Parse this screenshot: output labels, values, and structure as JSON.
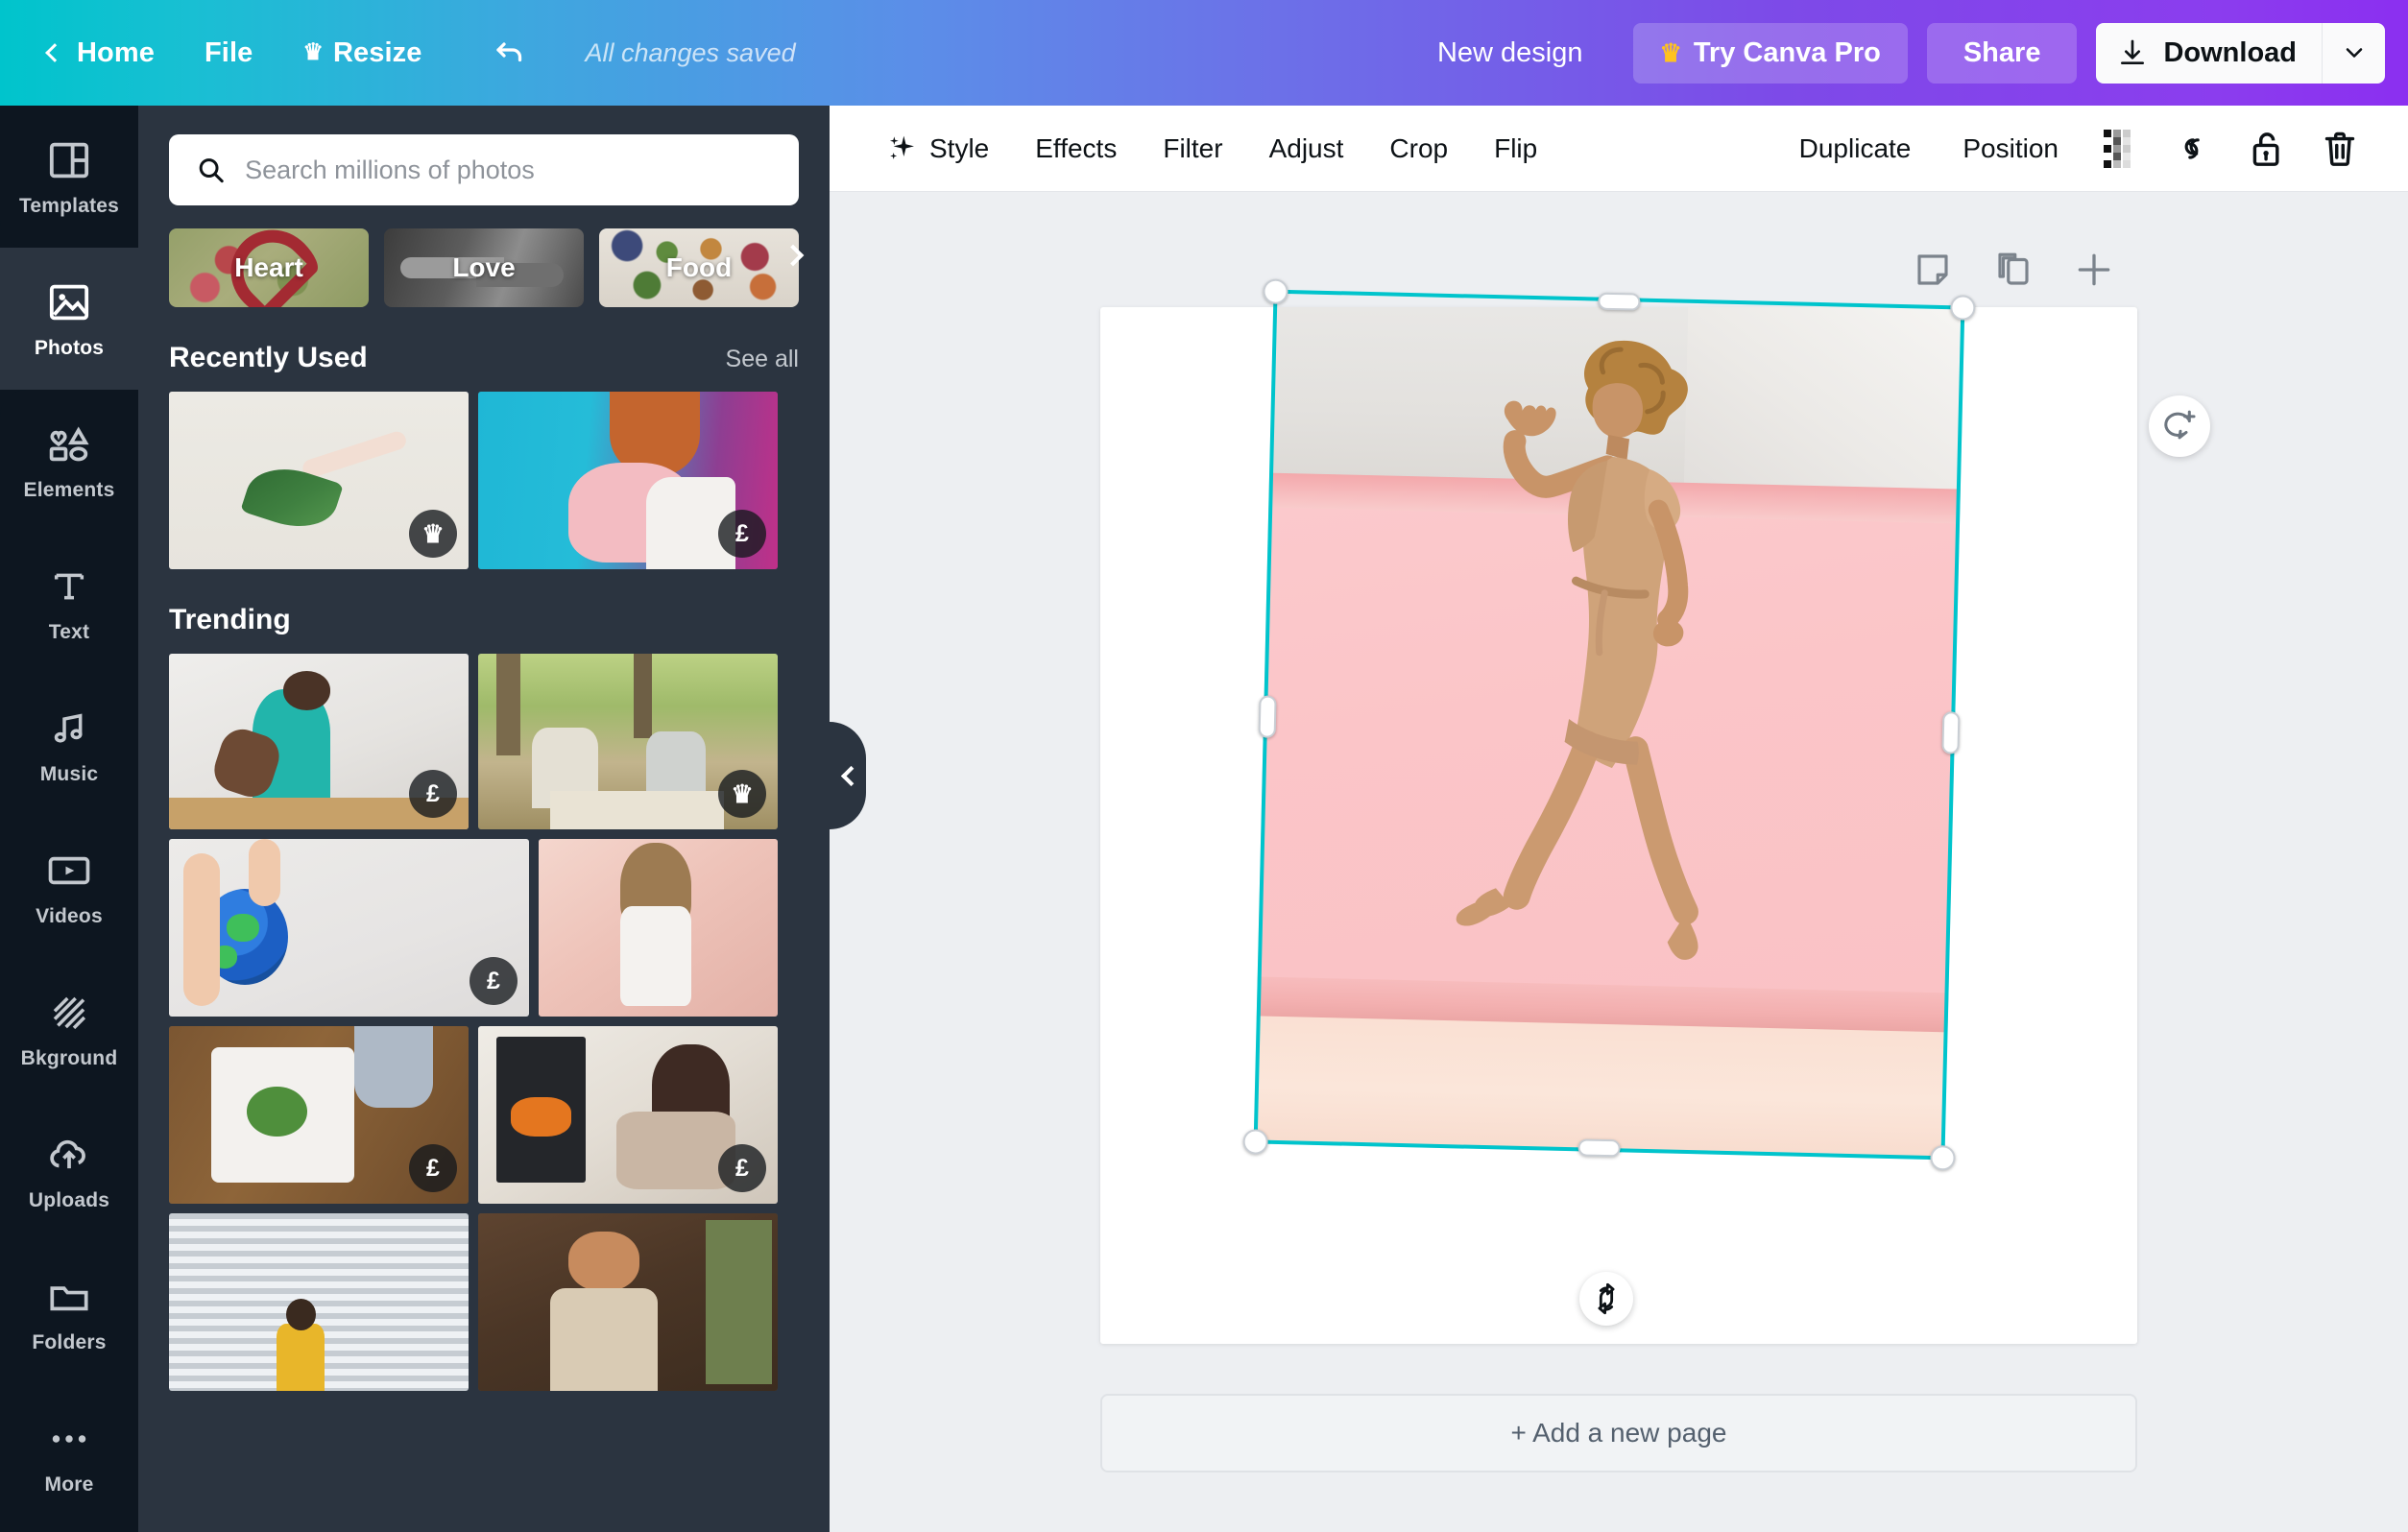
{
  "topbar": {
    "home": "Home",
    "file": "File",
    "resize": "Resize",
    "crown_icon": "crown-icon",
    "undo_icon": "undo-icon",
    "save_status": "All changes saved",
    "new_design": "New design",
    "try_pro": "Try Canva Pro",
    "share": "Share",
    "download": "Download",
    "download_caret_icon": "chevron-down-icon",
    "gradient_start": "#00c4cc",
    "gradient_end": "#8b2ff0"
  },
  "rail": {
    "items": [
      {
        "label": "Templates",
        "icon": "templates-icon",
        "active": false
      },
      {
        "label": "Photos",
        "icon": "photos-icon",
        "active": true
      },
      {
        "label": "Elements",
        "icon": "elements-icon",
        "active": false
      },
      {
        "label": "Text",
        "icon": "text-icon",
        "active": false
      },
      {
        "label": "Music",
        "icon": "music-icon",
        "active": false
      },
      {
        "label": "Videos",
        "icon": "videos-icon",
        "active": false
      },
      {
        "label": "Bkground",
        "icon": "background-icon",
        "active": false
      },
      {
        "label": "Uploads",
        "icon": "uploads-icon",
        "active": false
      },
      {
        "label": "Folders",
        "icon": "folders-icon",
        "active": false
      },
      {
        "label": "More",
        "icon": "more-icon",
        "active": false
      }
    ]
  },
  "panel": {
    "search": {
      "placeholder": "Search millions of photos",
      "value": "",
      "icon": "search-icon"
    },
    "chips": [
      {
        "label": "Heart"
      },
      {
        "label": "Love"
      },
      {
        "label": "Food"
      }
    ],
    "chips_next_icon": "chevron-right-icon",
    "collapse_icon": "chevron-left-icon",
    "sections": [
      {
        "title": "Recently Used",
        "link": "See all",
        "tiles": [
          {
            "name": "hand-holding-palm-leaf",
            "badge": "crown"
          },
          {
            "name": "woman-with-pink-roses",
            "badge": "£"
          }
        ]
      },
      {
        "title": "Trending",
        "link": "",
        "tiles": [
          {
            "name": "man-blending-smoothie",
            "badge": "£"
          },
          {
            "name": "friends-toasting-outdoor",
            "badge": "crown"
          },
          {
            "name": "hands-holding-globe",
            "badge": "£"
          },
          {
            "name": "woman-in-white-dress",
            "badge": ""
          },
          {
            "name": "washing-greens-in-sink",
            "badge": "£"
          },
          {
            "name": "woman-by-fireplace",
            "badge": "£"
          },
          {
            "name": "woman-by-window-blinds",
            "badge": ""
          },
          {
            "name": "bearded-shopkeeper",
            "badge": ""
          }
        ]
      }
    ]
  },
  "editor": {
    "context_tools": [
      {
        "label": "Style",
        "icon": "sparkle-icon"
      },
      {
        "label": "Effects",
        "icon": ""
      },
      {
        "label": "Filter",
        "icon": ""
      },
      {
        "label": "Adjust",
        "icon": ""
      },
      {
        "label": "Crop",
        "icon": ""
      },
      {
        "label": "Flip",
        "icon": ""
      }
    ],
    "context_right": [
      {
        "label": "Duplicate",
        "icon": ""
      },
      {
        "label": "Position",
        "icon": ""
      }
    ],
    "context_icons": [
      {
        "name": "transparency-icon"
      },
      {
        "name": "link-icon"
      },
      {
        "name": "unlock-icon"
      },
      {
        "name": "trash-icon"
      }
    ],
    "page_tools": [
      {
        "name": "notes-icon"
      },
      {
        "name": "duplicate-page-icon"
      },
      {
        "name": "add-page-icon"
      }
    ],
    "comment_icon": "add-comment-icon",
    "rotate_icon": "rotate-icon",
    "add_page_label": "+ Add a new page",
    "selection_color": "#00c4cc",
    "selected_element": "running-woman-pink-backdrop"
  }
}
